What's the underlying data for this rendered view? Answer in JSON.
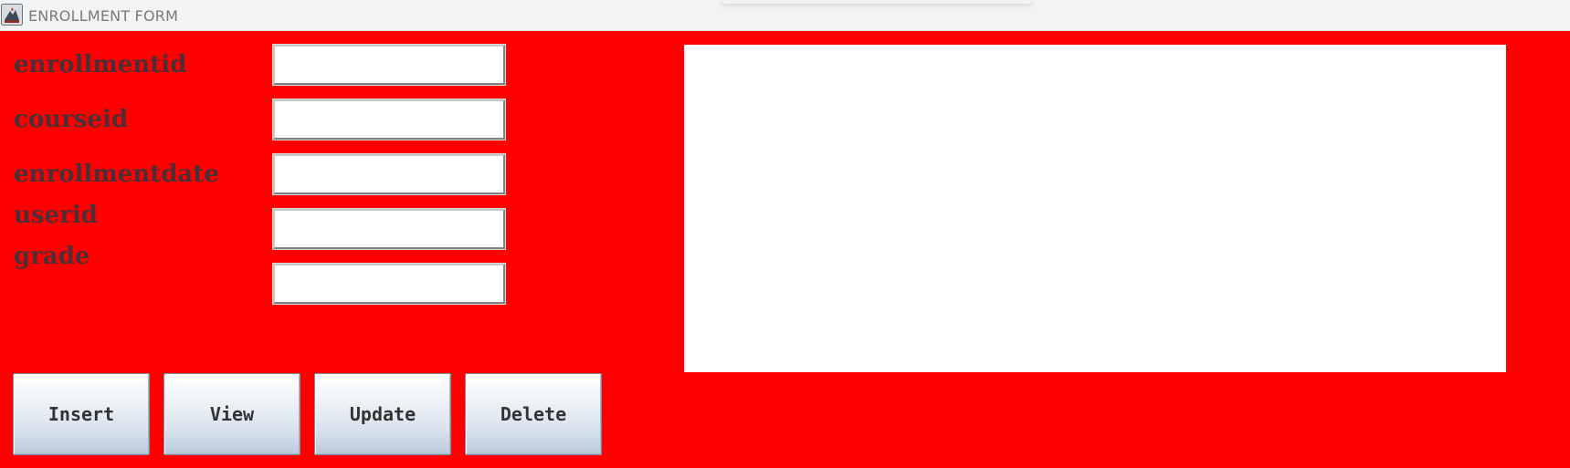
{
  "window": {
    "title": "ENROLLMENT FORM",
    "app_icon": "java-app-icon",
    "background_color": "#ff0000"
  },
  "form": {
    "fields": [
      {
        "label": "enrollmentid",
        "value": ""
      },
      {
        "label": "courseid",
        "value": ""
      },
      {
        "label": "enrollmentdate",
        "value": ""
      },
      {
        "label": "userid",
        "value": ""
      },
      {
        "label": "grade",
        "value": ""
      }
    ]
  },
  "output": {
    "content": ""
  },
  "buttons": {
    "insert": "Insert",
    "view": "View",
    "update": "Update",
    "delete": "Delete"
  }
}
